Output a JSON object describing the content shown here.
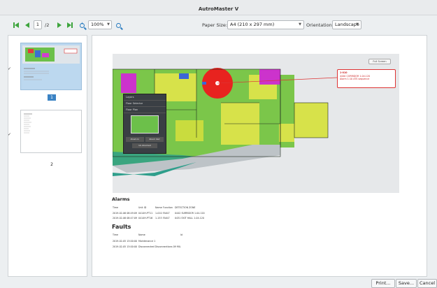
{
  "window": {
    "title": "AutroMaster V"
  },
  "toolbar": {
    "current_page": "1",
    "page_total": "/2",
    "zoom": "100%",
    "paper_size_label": "Paper Size:",
    "paper_size_value": "A4 (210 x 297 mm)",
    "orientation_label": "Orientation:",
    "orientation_value": "Landscape"
  },
  "thumbnails": [
    {
      "page": "1",
      "checked": "✓"
    },
    {
      "page": "2",
      "checked": "✓"
    }
  ],
  "report": {
    "alarm_callout": {
      "line1": "1-010",
      "line2": "4440 CORRIDOR 1.04.120",
      "line3": "Alarm   1:10   ATS   sequence"
    },
    "full_screen_btn": "Full Screen",
    "alarms_title": "Alarms",
    "alarms_headers": [
      "Time",
      "Unit ID",
      "Name",
      "Function",
      "DETECTION ZONE"
    ],
    "alarms_rows": [
      [
        "2019-02-06 08:49:09",
        "0414H-PT11",
        "1-010",
        "FAULT",
        "0442 SURRIDOR 1.04.120"
      ],
      [
        "2019-02-06 08:47:09",
        "0414H-PT16",
        "1-153",
        "FAULT",
        "0431 EXIT HALL 1.04.120"
      ]
    ],
    "faults_title": "Faults",
    "faults_headers": [
      "Time",
      "Name",
      "Id"
    ],
    "faults_rows": [
      [
        "2019-02-05 13:00:00",
        "Maintenance 1",
        ""
      ],
      [
        "2019-02-05 13:00:00",
        "Disconnected Disconnections 09 MIL",
        ""
      ]
    ],
    "menu_items": [
      "Layers",
      "Floor Selector",
      "Floor Plan"
    ],
    "panel_buttons": [
      "Zoom In",
      "Zoom Out",
      "Un-Zoomed"
    ]
  },
  "buttons": {
    "print": "Print...",
    "save": "Save...",
    "cancel": "Cancel"
  },
  "colors": {
    "accent_green": "#3ea53e",
    "accent_blue": "#3b83c4",
    "alarm_red": "#dd3333"
  }
}
